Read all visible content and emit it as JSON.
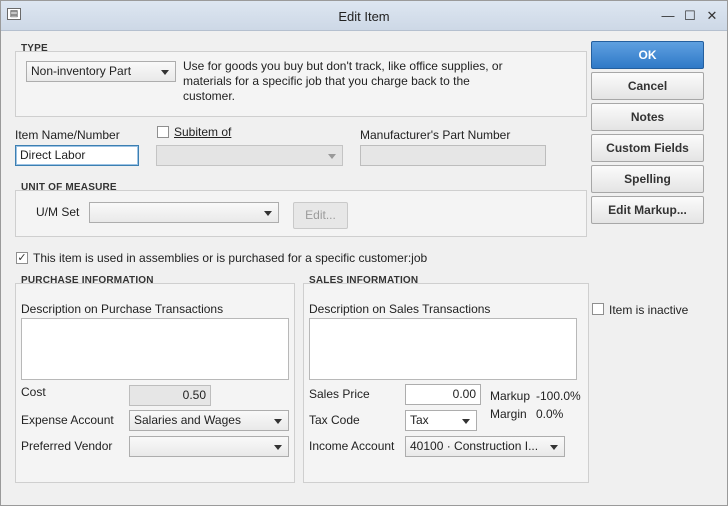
{
  "window": {
    "title": "Edit Item",
    "sysmenu_glyph": "▤",
    "minimize_glyph": "—",
    "maximize_glyph": "☐",
    "close_glyph": "✕"
  },
  "type": {
    "section_label": "TYPE",
    "value": "Non-inventory Part",
    "description": "Use for goods you buy but don't track, like office supplies, or materials for a specific job that you charge back to the customer."
  },
  "item": {
    "name_label": "Item Name/Number",
    "name_value": "Direct Labor",
    "subitem_label": "Subitem of",
    "subitem_checked": false,
    "subitem_value": "",
    "mfr_label": "Manufacturer's Part Number",
    "mfr_value": ""
  },
  "uom": {
    "section_label": "UNIT OF MEASURE",
    "set_label": "U/M Set",
    "set_value": "",
    "edit_button": "Edit..."
  },
  "assembly": {
    "checked": true,
    "label": "This item is used in assemblies or is purchased for a specific customer:job"
  },
  "purchase": {
    "section_label": "PURCHASE INFORMATION",
    "desc_label": "Description on Purchase Transactions",
    "desc_value": "",
    "cost_label": "Cost",
    "cost_value": "0.50",
    "expense_label": "Expense Account",
    "expense_value": "Salaries and Wages",
    "vendor_label": "Preferred Vendor",
    "vendor_value": ""
  },
  "sales": {
    "section_label": "SALES INFORMATION",
    "desc_label": "Description on Sales Transactions",
    "desc_value": "",
    "price_label": "Sales Price",
    "price_value": "0.00",
    "markup_label": "Markup",
    "markup_value": "-100.0%",
    "margin_label": "Margin",
    "margin_value": "0.0%",
    "tax_label": "Tax Code",
    "tax_value": "Tax",
    "income_label": "Income Account",
    "income_value": "40100 · Construction I..."
  },
  "inactive": {
    "checked": false,
    "label": "Item is inactive"
  },
  "buttons": {
    "ok": "OK",
    "cancel": "Cancel",
    "notes": "Notes",
    "custom_fields": "Custom Fields",
    "spelling": "Spelling",
    "edit_markup": "Edit Markup..."
  },
  "colors": {
    "primary_button": "#2f79c7",
    "titlebar": "#cdd8e6"
  }
}
